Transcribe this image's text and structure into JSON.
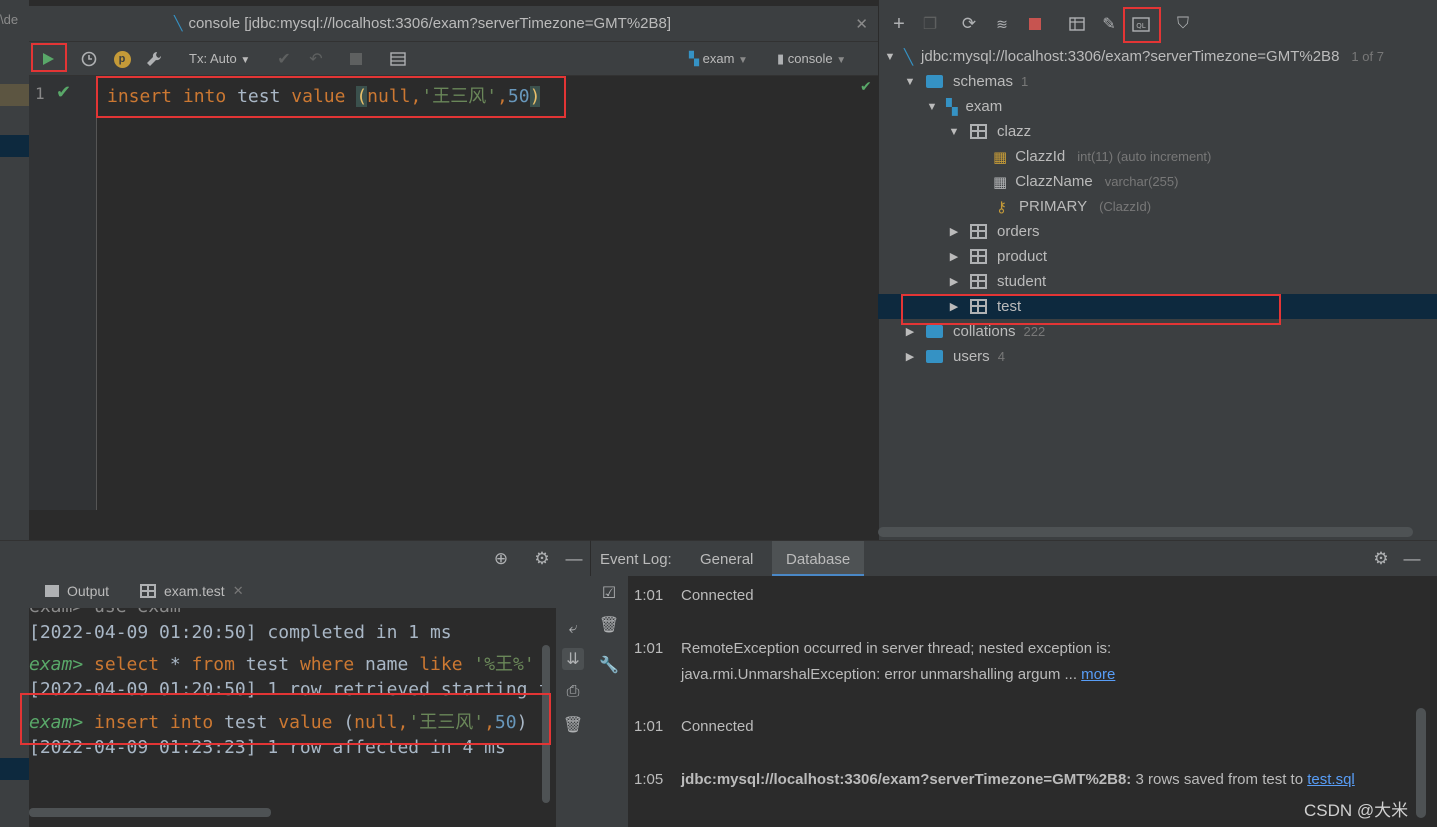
{
  "left_strip": {
    "text": "\\de"
  },
  "editor": {
    "tab_title": "console [jdbc:mysql://localhost:3306/exam?serverTimezone=GMT%2B8]",
    "toolbar": {
      "tx_mode": "Tx: Auto",
      "schema": "exam",
      "session": "console"
    },
    "line_number": "1",
    "code": {
      "kw1": "insert",
      "kw2": "into",
      "table": "test",
      "kw3": "value",
      "open": "(",
      "null": "null",
      "comma1": ",",
      "str": "'王三风'",
      "comma2": ",",
      "num": "50",
      "close": ")"
    }
  },
  "db_tree": {
    "datasource": "jdbc:mysql://localhost:3306/exam?serverTimezone=GMT%2B8",
    "datasource_count": "1 of 7",
    "schemas": {
      "label": "schemas",
      "count": "1"
    },
    "exam": "exam",
    "clazz": "clazz",
    "columns": [
      {
        "name": "ClazzId",
        "meta": "int(11) (auto increment)"
      },
      {
        "name": "ClazzName",
        "meta": "varchar(255)"
      }
    ],
    "primary": {
      "name": "PRIMARY",
      "meta": "(ClazzId)"
    },
    "tables": [
      "orders",
      "product",
      "student",
      "test"
    ],
    "collations": {
      "label": "collations",
      "count": "222"
    },
    "users": {
      "label": "users",
      "count": "4"
    }
  },
  "run_panel": {
    "tabs": [
      "Output",
      "exam.test"
    ],
    "lines": {
      "partial": "exam> use exam",
      "l1": "[2022-04-09 01:20:50] completed in 1 ms",
      "l2_prompt": "exam>",
      "l2_kw1": "select",
      "l2_star": " * ",
      "l2_kw2": "from",
      "l2_tbl": " test ",
      "l2_kw3": "where",
      "l2_col": " name ",
      "l2_kw4": "like",
      "l2_str": " '%王%'",
      "l3": "[2022-04-09 01:20:50] 1 row retrieved starting f",
      "l4_prompt": "exam>",
      "l4_kw1": "insert",
      "l4_kw2": "into",
      "l4_tbl": " test ",
      "l4_kw3": "value",
      "l4_open": " (",
      "l4_null": "null",
      "l4_c1": ",",
      "l4_str": "'王三风'",
      "l4_c2": ",",
      "l4_num": "50",
      "l4_close": ")",
      "l5": "[2022-04-09 01:23:23] 1 row affected in 4 ms"
    }
  },
  "event_log": {
    "title": "Event Log:",
    "tabs": [
      "General",
      "Database"
    ],
    "entries": [
      {
        "time": "1:01",
        "msg": "Connected"
      },
      {
        "time": "1:01",
        "msg": "RemoteException occurred in server thread; nested exception is:",
        "msg2": "java.rmi.UnmarshalException: error unmarshalling argum ...",
        "link": "more"
      },
      {
        "time": "1:01",
        "msg": "Connected"
      },
      {
        "time": "1:05",
        "bold": "jdbc:mysql://localhost:3306/exam?serverTimezone=GMT%2B8:",
        "msg": " 3 rows saved from test to ",
        "link": "test.sql"
      }
    ]
  },
  "watermark": "CSDN @大米"
}
